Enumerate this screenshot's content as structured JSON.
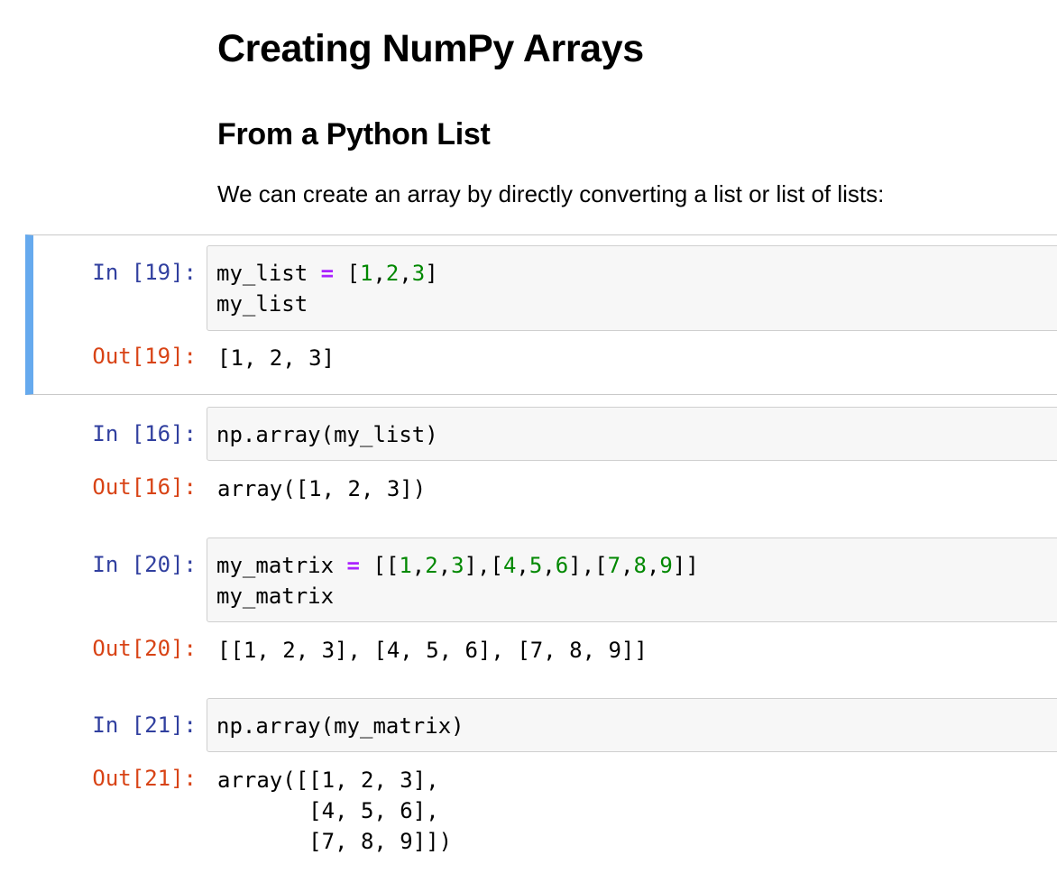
{
  "markdown": {
    "title": "Creating NumPy Arrays",
    "subtitle": "From a Python List",
    "description": "We can create an array by directly converting a list or list of lists:"
  },
  "cells": [
    {
      "in_prompt": "In [19]:",
      "code": "my_list = [1,2,3]\nmy_list",
      "out_prompt": "Out[19]:",
      "output": "[1, 2, 3]",
      "selected": true
    },
    {
      "in_prompt": "In [16]:",
      "code": "np.array(my_list)",
      "out_prompt": "Out[16]:",
      "output": "array([1, 2, 3])",
      "selected": false
    },
    {
      "in_prompt": "In [20]:",
      "code": "my_matrix = [[1,2,3],[4,5,6],[7,8,9]]\nmy_matrix",
      "out_prompt": "Out[20]:",
      "output": "[[1, 2, 3], [4, 5, 6], [7, 8, 9]]",
      "selected": false
    },
    {
      "in_prompt": "In [21]:",
      "code": "np.array(my_matrix)",
      "out_prompt": "Out[21]:",
      "output": "array([[1, 2, 3],\n       [4, 5, 6],\n       [7, 8, 9]])",
      "selected": false
    }
  ],
  "colors": {
    "in_prompt": "#303f9f",
    "out_prompt": "#d84315",
    "selected_bar": "#66aaee",
    "operator": "#aa22ff",
    "number": "#008800"
  }
}
